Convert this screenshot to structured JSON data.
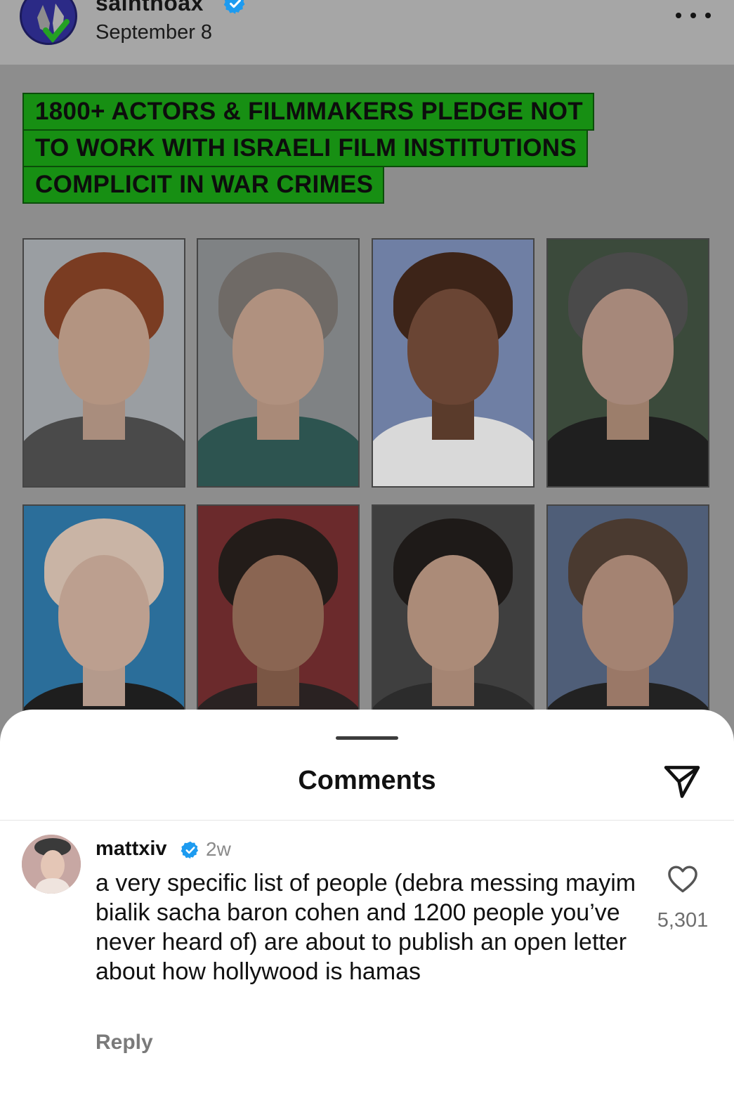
{
  "post": {
    "username": "saintnoax",
    "date": "September 8",
    "headline": [
      "1800+ ACTORS & FILMMAKERS PLEDGE NOT",
      "TO WORK WITH ISRAELI FILM INSTITUTIONS",
      "COMPLICIT IN WAR CRIMES"
    ]
  },
  "comments_sheet": {
    "title": "Comments",
    "comment": {
      "username": "mattxiv",
      "time": "2w",
      "text": "a very specific list of people (debra messing mayim bialik sacha baron cohen and 1200 people you’ve never heard of) are about to publish an open letter about how hollywood is hamas",
      "reply_label": "Reply",
      "like_count": "5,301"
    }
  },
  "icons": {
    "verified": "verified-badge-icon",
    "more": "more-options-icon",
    "share": "send-paper-plane-icon",
    "like": "heart-outline-icon"
  },
  "colors": {
    "headline_bg": "#178f13",
    "verified": "#1d9bf0"
  }
}
